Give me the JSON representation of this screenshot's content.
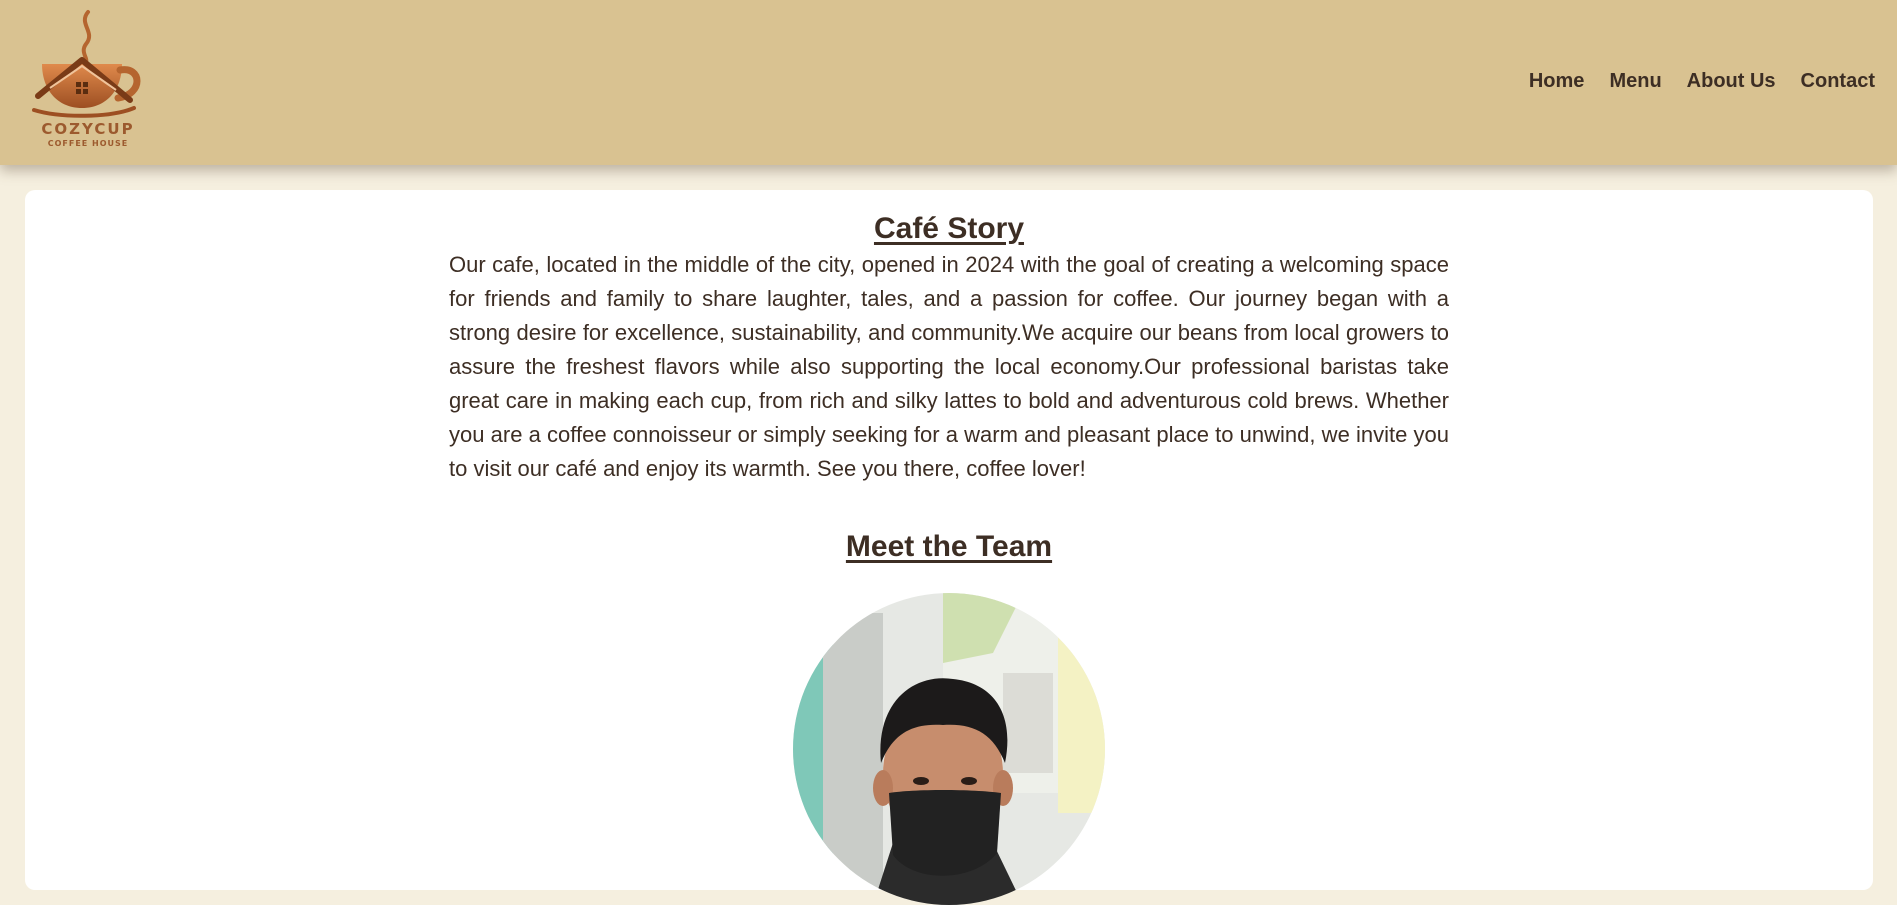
{
  "brand": {
    "name": "COZYCUP",
    "subtitle": "COFFEE HOUSE",
    "logo_icon": "coffee-cup-house-icon",
    "accent_color": "#b5652f"
  },
  "nav": {
    "items": [
      {
        "label": "Home"
      },
      {
        "label": "Menu"
      },
      {
        "label": "About Us"
      },
      {
        "label": "Contact"
      }
    ]
  },
  "story": {
    "title": "Café Story",
    "body": "Our cafe, located in the middle of the city, opened in 2024 with the goal of creating a welcoming space for friends and family to share laughter, tales, and a passion for coffee. Our journey began with a strong desire for excellence, sustainability, and community.We acquire our beans from local growers to assure the freshest flavors while also supporting the local economy.Our professional baristas take great care in making each cup, from rich and silky lattes to bold and adventurous cold brews. Whether you are a coffee connoisseur or simply seeking for a warm and pleasant place to unwind, we invite you to visit our café and enjoy its warmth. See you there, coffee lover!"
  },
  "team": {
    "title": "Meet the Team"
  },
  "colors": {
    "header_bg": "#d9c291",
    "page_bg": "#f5efdf",
    "text": "#3d2e24"
  }
}
